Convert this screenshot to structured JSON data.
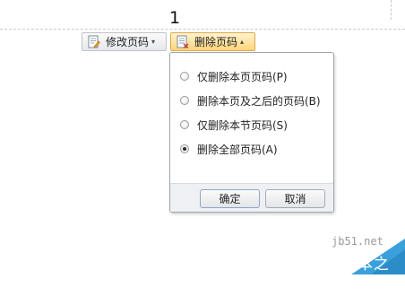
{
  "page": {
    "number": "1"
  },
  "toolbar": {
    "modify_label": "修改页码",
    "delete_label": "删除页码"
  },
  "popup": {
    "options": [
      {
        "label": "仅删除本页页码(P)",
        "selected": false
      },
      {
        "label": "删除本页及之后的页码(B)",
        "selected": false
      },
      {
        "label": "仅删除本节页码(S)",
        "selected": false
      },
      {
        "label": "删除全部页码(A)",
        "selected": true
      }
    ],
    "ok_label": "确定",
    "cancel_label": "取消"
  },
  "watermark": {
    "url": "jb51.net",
    "text": "脚本之家"
  },
  "colors": {
    "active_button": "#ffd67a",
    "active_border": "#e3a64d",
    "watermark_blue": "#3aa0dc"
  }
}
